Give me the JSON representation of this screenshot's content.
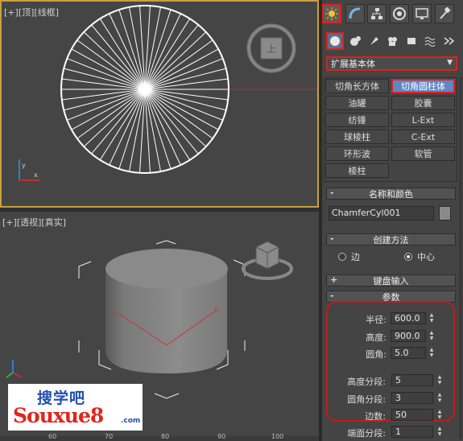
{
  "viewports": {
    "top": {
      "label_plus": "[+]",
      "label_view": "[顶]",
      "label_shading": "[线框]"
    },
    "perspective": {
      "label_plus": "[+]",
      "label_view": "[透视]",
      "label_shading": "[真实]"
    }
  },
  "viewcube": {
    "face_label": "上"
  },
  "watermark": {
    "cn": "搜学吧",
    "en": "Souxue8",
    "com": ".com"
  },
  "ruler": {
    "ticks": [
      "60",
      "70",
      "80",
      "90",
      "100"
    ]
  },
  "panel": {
    "tabs": [
      "create-tab",
      "modify-tab",
      "hierarchy-tab",
      "motion-tab",
      "display-tab",
      "utilities-tab"
    ],
    "subcategories": [
      "geometry",
      "shapes",
      "lights",
      "cameras",
      "helpers",
      "space-warps",
      "systems"
    ],
    "category_dropdown": "扩展基本体",
    "object_types": [
      {
        "label": "切角长方体",
        "active": false
      },
      {
        "label": "切角圆柱体",
        "active": true
      },
      {
        "label": "油罐",
        "active": false
      },
      {
        "label": "胶囊",
        "active": false
      },
      {
        "label": "纺锤",
        "active": false
      },
      {
        "label": "L-Ext",
        "active": false
      },
      {
        "label": "球棱柱",
        "active": false
      },
      {
        "label": "C-Ext",
        "active": false
      },
      {
        "label": "环形波",
        "active": false
      },
      {
        "label": "软管",
        "active": false
      },
      {
        "label": "棱柱",
        "active": false
      }
    ],
    "name_color": {
      "title": "名称和颜色",
      "sign": "-",
      "name": "ChamferCyl001",
      "color": "#8a8a8a"
    },
    "creation_method": {
      "title": "创建方法",
      "sign": "-",
      "options": [
        "边",
        "中心"
      ],
      "selected": "中心"
    },
    "keyboard_entry": {
      "title": "键盘输入",
      "sign": "+"
    },
    "parameters": {
      "title": "参数",
      "sign": "-",
      "radius_label": "半径:",
      "radius": "600.0",
      "height_label": "高度:",
      "height": "900.0",
      "fillet_label": "圆角:",
      "fillet": "5.0",
      "height_segs_label": "高度分段:",
      "height_segs": "5",
      "fillet_segs_label": "圆角分段:",
      "fillet_segs": "3",
      "sides_label": "边数:",
      "sides": "50",
      "cap_segs_label": "端面分段:",
      "cap_segs": "1"
    }
  },
  "colors": {
    "highlight_red": "#e0201b",
    "active_blue": "#5f86c7",
    "viewport_border": "#c8a03c"
  }
}
